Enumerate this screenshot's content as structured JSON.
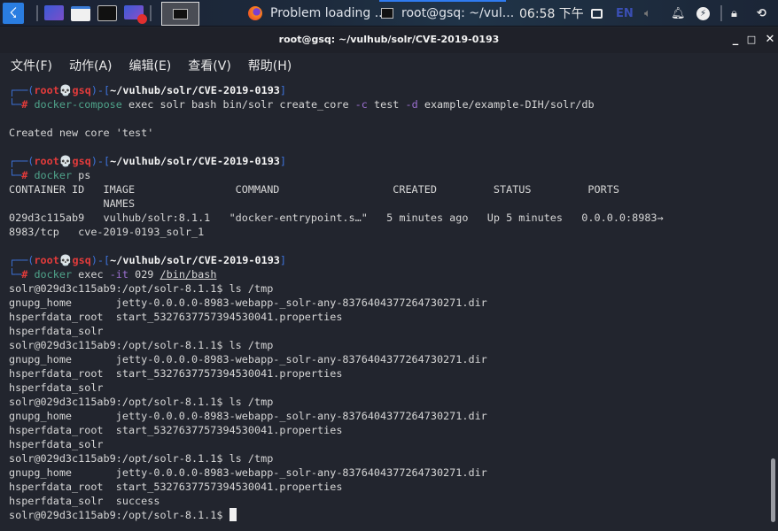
{
  "taskbar": {
    "launchers": [
      {
        "icon": "kali-menu-icon"
      },
      {
        "icon": "workspace-icon"
      },
      {
        "icon": "file-manager-icon"
      },
      {
        "icon": "terminal-icon"
      },
      {
        "icon": "screen-recorder-icon"
      }
    ],
    "tasks": [
      {
        "label": "Problem loading ...",
        "icon": "firefox-icon"
      },
      {
        "label": "root@gsq: ~/vul...",
        "icon": "terminal-icon"
      }
    ],
    "clock": "06:58 下午",
    "language": "EN",
    "tray_icons": [
      "display-icon",
      "volume-icon",
      "notification-bell-icon",
      "power-manager-icon",
      "lock-icon",
      "logout-icon"
    ]
  },
  "window": {
    "title": "root@gsq: ~/vulhub/solr/CVE-2019-0193",
    "controls": {
      "minimize": "_",
      "maximize": "□",
      "close": "✕"
    }
  },
  "menu": [
    "文件(F)",
    "动作(A)",
    "编辑(E)",
    "查看(V)",
    "帮助(H)"
  ],
  "colors": {
    "prompt_bracket": "#3d72d9",
    "prompt_user": "#e23b3b",
    "command": "#4fa38a",
    "flag": "#9b6fd0",
    "background": "#22252e"
  },
  "terminal": {
    "lines": [
      [
        {
          "t": "┌──(",
          "c": "b"
        },
        {
          "t": "root💀gsq",
          "c": "r"
        },
        {
          "t": ")-[",
          "c": "b"
        },
        {
          "t": "~/vulhub/solr/CVE-2019-0193",
          "c": "w"
        },
        {
          "t": "]",
          "c": "b"
        }
      ],
      [
        {
          "t": "└─",
          "c": "b"
        },
        {
          "t": "# ",
          "c": "r"
        },
        {
          "t": "docker-compose",
          "c": "g"
        },
        {
          "t": " exec solr bash bin/solr create_core ",
          "c": "d"
        },
        {
          "t": "-c",
          "c": "p"
        },
        {
          "t": " test ",
          "c": "d"
        },
        {
          "t": "-d",
          "c": "p"
        },
        {
          "t": " example/example-DIH/solr/db",
          "c": "d"
        }
      ],
      [],
      [
        {
          "t": "Created new core 'test'",
          "c": "d"
        }
      ],
      [],
      [
        {
          "t": "┌──(",
          "c": "b"
        },
        {
          "t": "root💀gsq",
          "c": "r"
        },
        {
          "t": ")-[",
          "c": "b"
        },
        {
          "t": "~/vulhub/solr/CVE-2019-0193",
          "c": "w"
        },
        {
          "t": "]",
          "c": "b"
        }
      ],
      [
        {
          "t": "└─",
          "c": "b"
        },
        {
          "t": "# ",
          "c": "r"
        },
        {
          "t": "docker",
          "c": "g"
        },
        {
          "t": " ps",
          "c": "d"
        }
      ],
      [
        {
          "t": "CONTAINER ID   IMAGE                COMMAND                  CREATED         STATUS         PORTS",
          "c": "d"
        }
      ],
      [
        {
          "t": "               NAMES",
          "c": "d"
        }
      ],
      [
        {
          "t": "029d3c115ab9   vulhub/solr:8.1.1   \"docker-entrypoint.s…\"   5 minutes ago   Up 5 minutes   0.0.0.0:8983→",
          "c": "d"
        }
      ],
      [
        {
          "t": "8983/tcp   cve-2019-0193_solr_1",
          "c": "d"
        }
      ],
      [],
      [
        {
          "t": "┌──(",
          "c": "b"
        },
        {
          "t": "root💀gsq",
          "c": "r"
        },
        {
          "t": ")-[",
          "c": "b"
        },
        {
          "t": "~/vulhub/solr/CVE-2019-0193",
          "c": "w"
        },
        {
          "t": "]",
          "c": "b"
        }
      ],
      [
        {
          "t": "└─",
          "c": "b"
        },
        {
          "t": "# ",
          "c": "r"
        },
        {
          "t": "docker",
          "c": "g"
        },
        {
          "t": " exec ",
          "c": "d"
        },
        {
          "t": "-it",
          "c": "p"
        },
        {
          "t": " 029 ",
          "c": "d"
        },
        {
          "t": "/bin/bash",
          "c": "u"
        }
      ],
      [
        {
          "t": "solr@029d3c115ab9:/opt/solr-8.1.1$ ls /tmp",
          "c": "d"
        }
      ],
      [
        {
          "t": "gnupg_home       jetty-0.0.0.0-8983-webapp-_solr-any-8376404377264730271.dir",
          "c": "d"
        }
      ],
      [
        {
          "t": "hsperfdata_root  start_5327637757394530041.properties",
          "c": "d"
        }
      ],
      [
        {
          "t": "hsperfdata_solr",
          "c": "d"
        }
      ],
      [
        {
          "t": "solr@029d3c115ab9:/opt/solr-8.1.1$ ls /tmp",
          "c": "d"
        }
      ],
      [
        {
          "t": "gnupg_home       jetty-0.0.0.0-8983-webapp-_solr-any-8376404377264730271.dir",
          "c": "d"
        }
      ],
      [
        {
          "t": "hsperfdata_root  start_5327637757394530041.properties",
          "c": "d"
        }
      ],
      [
        {
          "t": "hsperfdata_solr",
          "c": "d"
        }
      ],
      [
        {
          "t": "solr@029d3c115ab9:/opt/solr-8.1.1$ ls /tmp",
          "c": "d"
        }
      ],
      [
        {
          "t": "gnupg_home       jetty-0.0.0.0-8983-webapp-_solr-any-8376404377264730271.dir",
          "c": "d"
        }
      ],
      [
        {
          "t": "hsperfdata_root  start_5327637757394530041.properties",
          "c": "d"
        }
      ],
      [
        {
          "t": "hsperfdata_solr",
          "c": "d"
        }
      ],
      [
        {
          "t": "solr@029d3c115ab9:/opt/solr-8.1.1$ ls /tmp",
          "c": "d"
        }
      ],
      [
        {
          "t": "gnupg_home       jetty-0.0.0.0-8983-webapp-_solr-any-8376404377264730271.dir",
          "c": "d"
        }
      ],
      [
        {
          "t": "hsperfdata_root  start_5327637757394530041.properties",
          "c": "d"
        }
      ],
      [
        {
          "t": "hsperfdata_solr  success",
          "c": "d"
        }
      ],
      [
        {
          "t": "solr@029d3c115ab9:/opt/solr-8.1.1$ ",
          "c": "d"
        }
      ]
    ]
  }
}
